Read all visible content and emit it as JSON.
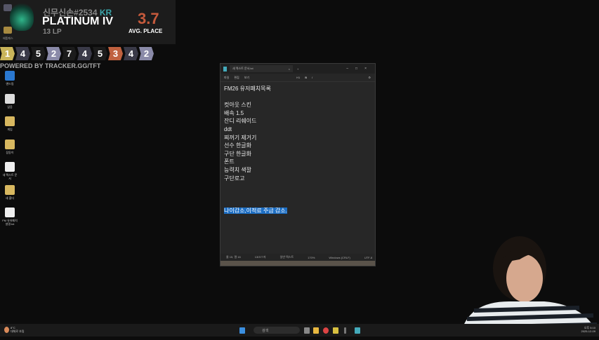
{
  "tracker": {
    "name": "신무신손#2534",
    "region": "KR",
    "rank": "PLATINUM IV",
    "lp": "13 LP",
    "avg": "3.7",
    "avg_label": "AVG. PLACE",
    "side_label": "배틀패스",
    "powered": "POWERED BY TRACKER.GG/TFT",
    "places": [
      {
        "v": "1",
        "c": "#c9b45a"
      },
      {
        "v": "4",
        "c": "#3a3a48"
      },
      {
        "v": "5",
        "c": "#1c1c1c"
      },
      {
        "v": "2",
        "c": "#8a8aa8"
      },
      {
        "v": "7",
        "c": "#1c1c1c"
      },
      {
        "v": "4",
        "c": "#3a3a48"
      },
      {
        "v": "5",
        "c": "#1c1c1c"
      },
      {
        "v": "3",
        "c": "#c0613f"
      },
      {
        "v": "4",
        "c": "#3a3a48"
      },
      {
        "v": "2",
        "c": "#8a8aa8"
      }
    ]
  },
  "desktop": [
    {
      "label": "앤드림",
      "color": "#2a78d0"
    },
    {
      "label": "없음",
      "color": "#ddd"
    },
    {
      "label": "게임",
      "color": "#d8b860"
    },
    {
      "label": "잡동이",
      "color": "#d8b860"
    },
    {
      "label": "새 텍스트 문서",
      "color": "#eee"
    },
    {
      "label": "새 폴더",
      "color": "#d8b860"
    },
    {
      "label": "FM 유저패치 설명.txt",
      "color": "#eee"
    }
  ],
  "notepad": {
    "tab": "새 텍스트 문서.txt",
    "menu": [
      "파일",
      "편집",
      "보기"
    ],
    "format": [
      "H1",
      "B",
      "I"
    ],
    "lines": [
      "FM26 유저패치목록",
      "",
      "컷아웃 스킨",
      "배속 1.5",
      "잔디 리쉐이드",
      "ddt",
      "찌꺼기 제거기",
      "선수 한글화",
      "구단 한글화",
      "폰트",
      "능력치 색깔",
      "구단로고",
      "",
      "",
      ""
    ],
    "selected": "나이감소,이적료 주급 감소.",
    "status": [
      "줄 15, 열 16",
      "13/377자",
      "일반 텍스트",
      "170%",
      "Windows (CRLF)",
      "UTF-8"
    ]
  },
  "taskbar": {
    "weather": "8°C",
    "weather_sub": "대체로 흐림",
    "search": "검색",
    "time": "오후 5:10",
    "date": "2025-12-09"
  }
}
